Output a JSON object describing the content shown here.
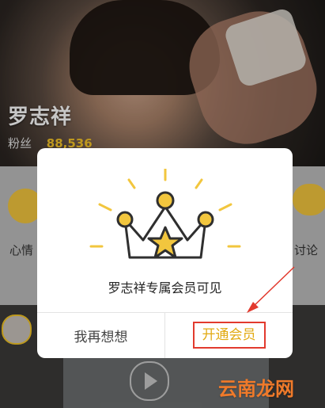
{
  "header": {
    "artist_name": "罗志祥",
    "fans_label": "粉丝",
    "fans_count": "88,536"
  },
  "strip": {
    "left_label": "心情",
    "right_label": "讨论"
  },
  "modal": {
    "message": "罗志祥专属会员可见",
    "cancel_label": "我再想想",
    "confirm_label": "开通会员"
  },
  "watermark": "云南龙网",
  "colors": {
    "accent": "#f4c327",
    "confirm_text": "#e2aa13",
    "annotation": "#e23a2e"
  },
  "icons": {
    "crown": "crown-with-star-icon",
    "play": "play-icon"
  }
}
